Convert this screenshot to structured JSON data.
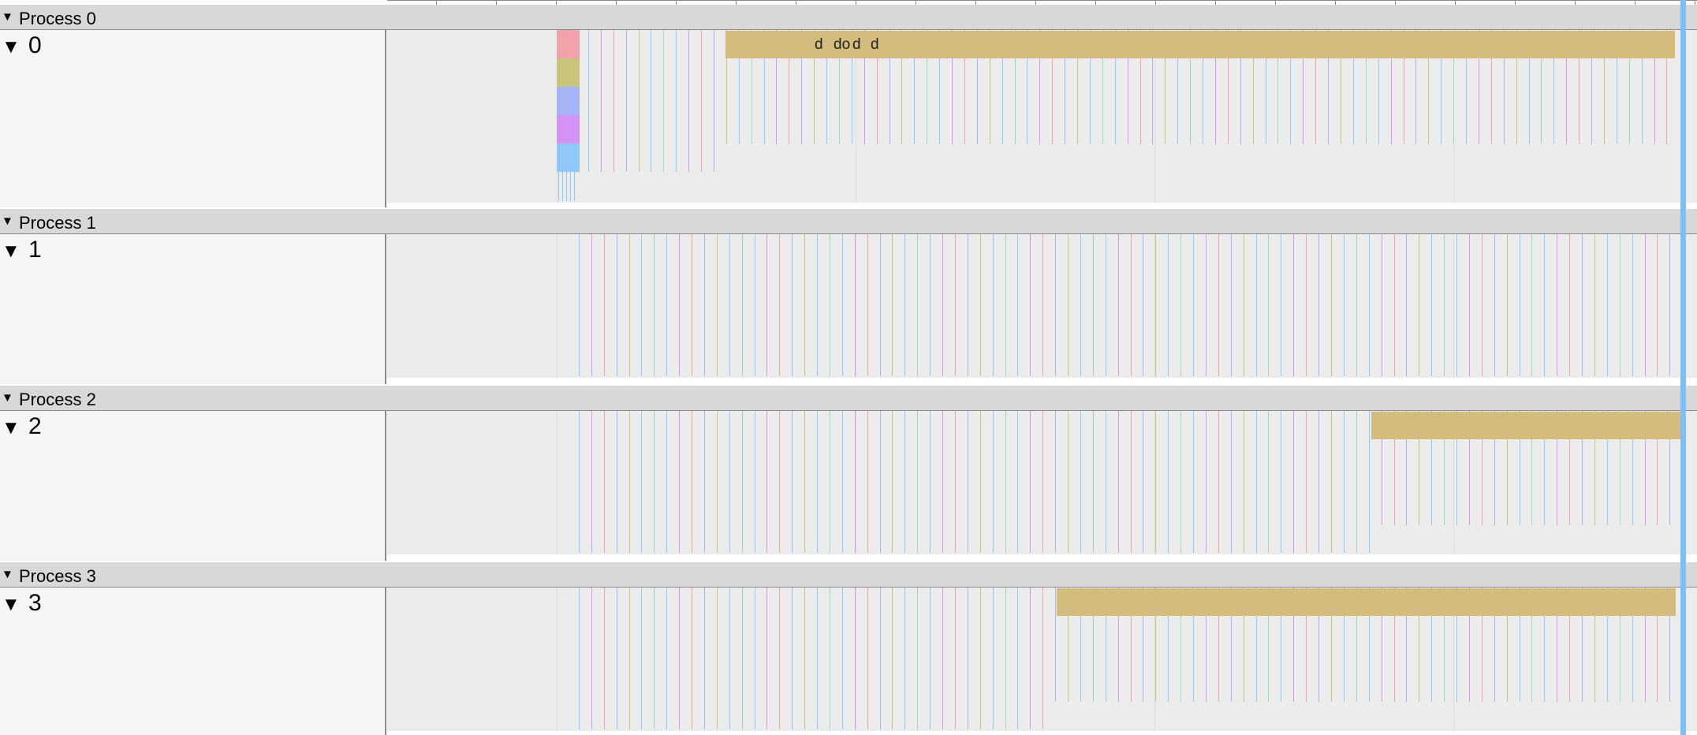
{
  "processes": [
    {
      "name": "Process 0",
      "thread": "0"
    },
    {
      "name": "Process 1",
      "thread": "1"
    },
    {
      "name": "Process 2",
      "thread": "2"
    },
    {
      "name": "Process 3",
      "thread": "3"
    }
  ],
  "slice_labels": [
    "d",
    "do",
    "d",
    "d"
  ],
  "icons": {
    "expand": "triangle-down-icon"
  },
  "colors": {
    "slice_gold": "#d4bd7c",
    "slice_pink": "#f2a2ab",
    "slice_olive": "#c8c57a",
    "slice_blue": "#a3b5f5",
    "slice_purple": "#d394f5",
    "slice_cyan": "#8ec9f9",
    "cursor": "#7fbef8",
    "header_bg": "#d8d8d8",
    "label_bg": "#f4f5f7",
    "track_bg": "#ececec"
  }
}
